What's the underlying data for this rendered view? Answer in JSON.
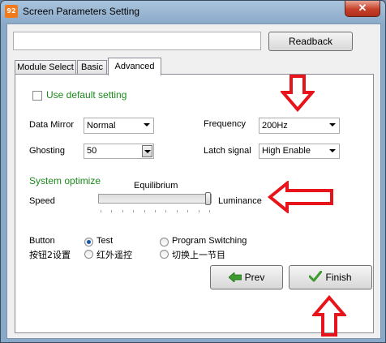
{
  "window": {
    "title": "Screen Parameters Setting",
    "icon_text": "92",
    "close_label": "✕"
  },
  "top": {
    "readback_value": "",
    "readback_label": "Readback"
  },
  "tabs": [
    {
      "label": "Module Select",
      "active": false
    },
    {
      "label": "Basic",
      "active": false
    },
    {
      "label": "Advanced",
      "active": true
    }
  ],
  "advanced": {
    "use_default_label": "Use default setting",
    "use_default_checked": false,
    "data_mirror_label": "Data Mirror",
    "data_mirror_value": "Normal",
    "frequency_label": "Frequency",
    "frequency_value": "200Hz",
    "ghosting_label": "Ghosting",
    "ghosting_value": "50",
    "latch_label": "Latch signal",
    "latch_value": "High Enable",
    "system_optimize_label": "System optimize",
    "equilibrium_label": "Equilibrium",
    "speed_label": "Speed",
    "luminance_label": "Luminance",
    "slider_value_fraction": 1.0
  },
  "button_setting": {
    "label_en": "Button",
    "label_cn": "按钮2设置",
    "options": [
      {
        "label": "Test",
        "selected": true
      },
      {
        "label": "红外遥控",
        "selected": false
      },
      {
        "label": "Program Switching",
        "selected": false
      },
      {
        "label": "切换上一节目",
        "selected": false
      }
    ]
  },
  "footer": {
    "prev_label": "Prev",
    "finish_label": "Finish"
  },
  "colors": {
    "annotation_arrow": "#e8141b",
    "accent_green": "#1b8a1b"
  }
}
